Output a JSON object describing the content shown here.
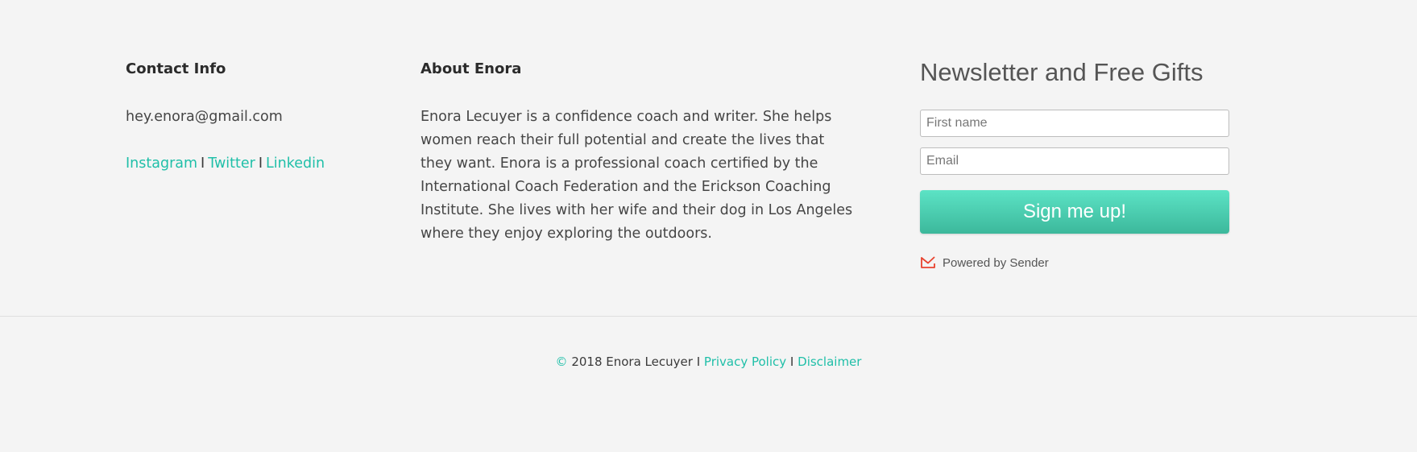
{
  "contact": {
    "title": "Contact Info",
    "email": "hey.enora@gmail.com",
    "social": [
      {
        "label": "Instagram"
      },
      {
        "label": "Twitter"
      },
      {
        "label": "Linkedin"
      }
    ],
    "separator": "I"
  },
  "about": {
    "title": "About Enora",
    "text": "Enora Lecuyer is a confidence coach and writer. She helps women reach their full potential and create the lives that they want. Enora is a professional coach certified by the International Coach Federation and the Erickson Coaching Institute. She lives with her wife and their dog in Los Angeles where they enjoy exploring the outdoors."
  },
  "newsletter": {
    "title": "Newsletter and Free Gifts",
    "first_name_placeholder": "First name",
    "email_placeholder": "Email",
    "button_label": "Sign me up!",
    "powered_by": "Powered by Sender",
    "sender_icon": "envelope-check-icon"
  },
  "bottom": {
    "copyright_symbol": "©",
    "copyright_text": "2018 Enora Lecuyer",
    "separator": "I",
    "privacy_label": "Privacy Policy",
    "disclaimer_label": "Disclaimer"
  },
  "colors": {
    "accent": "#1fbfa8",
    "button_top": "#5ce3c5",
    "button_bottom": "#3cb89b",
    "background": "#f4f4f4",
    "sender_red": "#e8432f"
  }
}
